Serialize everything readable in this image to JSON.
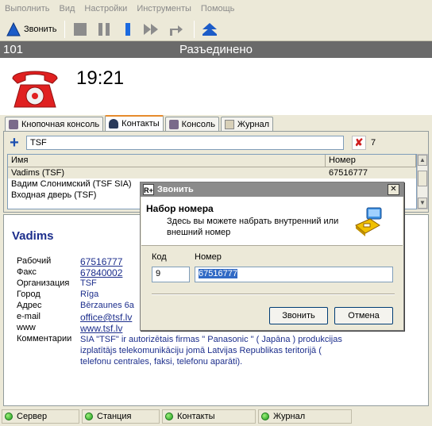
{
  "menu": [
    "Выполнить",
    "Вид",
    "Настройки",
    "Инструменты",
    "Помощь"
  ],
  "toolbar": {
    "call_label": "Звонить"
  },
  "status": {
    "extension": "101",
    "state": "Разъединено",
    "timer": "19:21"
  },
  "tabs": [
    {
      "label": "Кнопочная консоль"
    },
    {
      "label": "Контакты"
    },
    {
      "label": "Консоль"
    },
    {
      "label": "Журнал"
    }
  ],
  "search": {
    "value": "TSF",
    "count": "7"
  },
  "grid": {
    "headers": [
      "Имя",
      "Номер"
    ],
    "rows": [
      {
        "name": "Vadims (TSF)",
        "number": "67516777"
      },
      {
        "name": "Вадим Слонимский (TSF SIA)",
        "number": ""
      },
      {
        "name": "Входная дверь (TSF)",
        "number": ""
      }
    ]
  },
  "contact": {
    "name": "Vadims",
    "fields": [
      {
        "label": "Рабочий",
        "value": "67516777"
      },
      {
        "label": "Факс",
        "value": "67840002"
      },
      {
        "label": "Организация",
        "value": "TSF"
      },
      {
        "label": "Город",
        "value": "Rīga"
      },
      {
        "label": "Адрес",
        "value": "Bērzaunes 6a"
      },
      {
        "label": "e-mail",
        "value": "office@tsf.lv"
      },
      {
        "label": "www",
        "value": "www.tsf.lv"
      },
      {
        "label": "Комментарии",
        "value": "SIA \"TSF\" ir autorizētais firmas \" Panasonic \" ( Japāna ) produkcijas izplatītājs telekomunikāciju jomā Latvijas Republikas teritorijā ( telefonu centrales, faksi, telefonu aparāti)."
      }
    ]
  },
  "dialog": {
    "title": "Звонить",
    "heading": "Набор номера",
    "description": "Здесь вы можете набрать внутренний или внешний номер",
    "code_label": "Код",
    "code_value": "9",
    "number_label": "Номер",
    "number_value": "67516777",
    "ok_label": "Звонить",
    "cancel_label": "Отмена"
  },
  "statusbar": [
    "Сервер",
    "Станция",
    "Контакты",
    "Журнал"
  ],
  "colors": {
    "accent_blue": "#1c2e8c",
    "status_green": "#1e9b1e",
    "header_gray": "#6a6a6a"
  }
}
